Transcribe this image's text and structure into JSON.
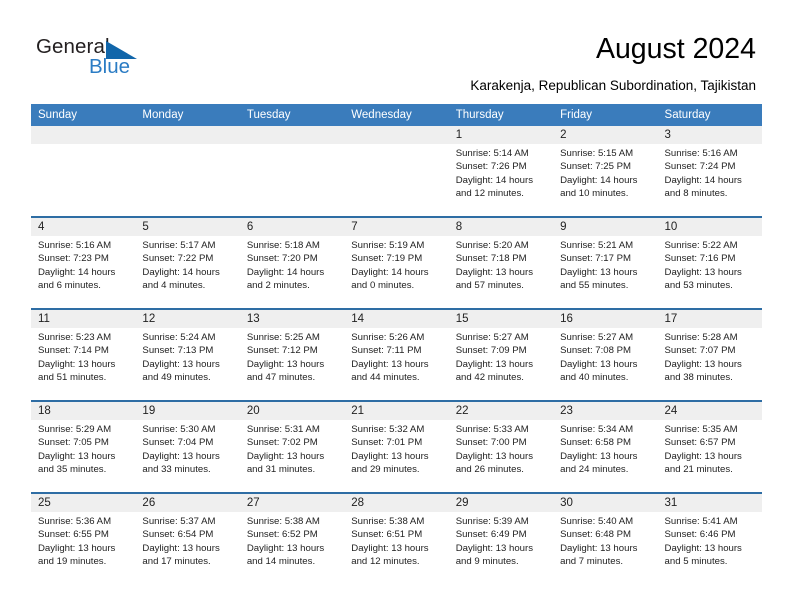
{
  "brand": {
    "name_part1": "General",
    "name_part2": "Blue",
    "mark": "triangle-flag-icon",
    "accent_color": "#2b7cc4"
  },
  "header": {
    "title": "August 2024",
    "subtitle": "Karakenja, Republican Subordination, Tajikistan"
  },
  "colors": {
    "header_blue": "#3a7cbc",
    "separator_blue": "#2e6da4",
    "daynum_band": "#efefef"
  },
  "calendar": {
    "weekday_headers": [
      "Sunday",
      "Monday",
      "Tuesday",
      "Wednesday",
      "Thursday",
      "Friday",
      "Saturday"
    ],
    "weeks": [
      [
        {
          "day": "",
          "sunrise": "",
          "sunset": "",
          "daylight_line1": "",
          "daylight_line2": ""
        },
        {
          "day": "",
          "sunrise": "",
          "sunset": "",
          "daylight_line1": "",
          "daylight_line2": ""
        },
        {
          "day": "",
          "sunrise": "",
          "sunset": "",
          "daylight_line1": "",
          "daylight_line2": ""
        },
        {
          "day": "",
          "sunrise": "",
          "sunset": "",
          "daylight_line1": "",
          "daylight_line2": ""
        },
        {
          "day": "1",
          "sunrise": "Sunrise: 5:14 AM",
          "sunset": "Sunset: 7:26 PM",
          "daylight_line1": "Daylight: 14 hours",
          "daylight_line2": "and 12 minutes."
        },
        {
          "day": "2",
          "sunrise": "Sunrise: 5:15 AM",
          "sunset": "Sunset: 7:25 PM",
          "daylight_line1": "Daylight: 14 hours",
          "daylight_line2": "and 10 minutes."
        },
        {
          "day": "3",
          "sunrise": "Sunrise: 5:16 AM",
          "sunset": "Sunset: 7:24 PM",
          "daylight_line1": "Daylight: 14 hours",
          "daylight_line2": "and 8 minutes."
        }
      ],
      [
        {
          "day": "4",
          "sunrise": "Sunrise: 5:16 AM",
          "sunset": "Sunset: 7:23 PM",
          "daylight_line1": "Daylight: 14 hours",
          "daylight_line2": "and 6 minutes."
        },
        {
          "day": "5",
          "sunrise": "Sunrise: 5:17 AM",
          "sunset": "Sunset: 7:22 PM",
          "daylight_line1": "Daylight: 14 hours",
          "daylight_line2": "and 4 minutes."
        },
        {
          "day": "6",
          "sunrise": "Sunrise: 5:18 AM",
          "sunset": "Sunset: 7:20 PM",
          "daylight_line1": "Daylight: 14 hours",
          "daylight_line2": "and 2 minutes."
        },
        {
          "day": "7",
          "sunrise": "Sunrise: 5:19 AM",
          "sunset": "Sunset: 7:19 PM",
          "daylight_line1": "Daylight: 14 hours",
          "daylight_line2": "and 0 minutes."
        },
        {
          "day": "8",
          "sunrise": "Sunrise: 5:20 AM",
          "sunset": "Sunset: 7:18 PM",
          "daylight_line1": "Daylight: 13 hours",
          "daylight_line2": "and 57 minutes."
        },
        {
          "day": "9",
          "sunrise": "Sunrise: 5:21 AM",
          "sunset": "Sunset: 7:17 PM",
          "daylight_line1": "Daylight: 13 hours",
          "daylight_line2": "and 55 minutes."
        },
        {
          "day": "10",
          "sunrise": "Sunrise: 5:22 AM",
          "sunset": "Sunset: 7:16 PM",
          "daylight_line1": "Daylight: 13 hours",
          "daylight_line2": "and 53 minutes."
        }
      ],
      [
        {
          "day": "11",
          "sunrise": "Sunrise: 5:23 AM",
          "sunset": "Sunset: 7:14 PM",
          "daylight_line1": "Daylight: 13 hours",
          "daylight_line2": "and 51 minutes."
        },
        {
          "day": "12",
          "sunrise": "Sunrise: 5:24 AM",
          "sunset": "Sunset: 7:13 PM",
          "daylight_line1": "Daylight: 13 hours",
          "daylight_line2": "and 49 minutes."
        },
        {
          "day": "13",
          "sunrise": "Sunrise: 5:25 AM",
          "sunset": "Sunset: 7:12 PM",
          "daylight_line1": "Daylight: 13 hours",
          "daylight_line2": "and 47 minutes."
        },
        {
          "day": "14",
          "sunrise": "Sunrise: 5:26 AM",
          "sunset": "Sunset: 7:11 PM",
          "daylight_line1": "Daylight: 13 hours",
          "daylight_line2": "and 44 minutes."
        },
        {
          "day": "15",
          "sunrise": "Sunrise: 5:27 AM",
          "sunset": "Sunset: 7:09 PM",
          "daylight_line1": "Daylight: 13 hours",
          "daylight_line2": "and 42 minutes."
        },
        {
          "day": "16",
          "sunrise": "Sunrise: 5:27 AM",
          "sunset": "Sunset: 7:08 PM",
          "daylight_line1": "Daylight: 13 hours",
          "daylight_line2": "and 40 minutes."
        },
        {
          "day": "17",
          "sunrise": "Sunrise: 5:28 AM",
          "sunset": "Sunset: 7:07 PM",
          "daylight_line1": "Daylight: 13 hours",
          "daylight_line2": "and 38 minutes."
        }
      ],
      [
        {
          "day": "18",
          "sunrise": "Sunrise: 5:29 AM",
          "sunset": "Sunset: 7:05 PM",
          "daylight_line1": "Daylight: 13 hours",
          "daylight_line2": "and 35 minutes."
        },
        {
          "day": "19",
          "sunrise": "Sunrise: 5:30 AM",
          "sunset": "Sunset: 7:04 PM",
          "daylight_line1": "Daylight: 13 hours",
          "daylight_line2": "and 33 minutes."
        },
        {
          "day": "20",
          "sunrise": "Sunrise: 5:31 AM",
          "sunset": "Sunset: 7:02 PM",
          "daylight_line1": "Daylight: 13 hours",
          "daylight_line2": "and 31 minutes."
        },
        {
          "day": "21",
          "sunrise": "Sunrise: 5:32 AM",
          "sunset": "Sunset: 7:01 PM",
          "daylight_line1": "Daylight: 13 hours",
          "daylight_line2": "and 29 minutes."
        },
        {
          "day": "22",
          "sunrise": "Sunrise: 5:33 AM",
          "sunset": "Sunset: 7:00 PM",
          "daylight_line1": "Daylight: 13 hours",
          "daylight_line2": "and 26 minutes."
        },
        {
          "day": "23",
          "sunrise": "Sunrise: 5:34 AM",
          "sunset": "Sunset: 6:58 PM",
          "daylight_line1": "Daylight: 13 hours",
          "daylight_line2": "and 24 minutes."
        },
        {
          "day": "24",
          "sunrise": "Sunrise: 5:35 AM",
          "sunset": "Sunset: 6:57 PM",
          "daylight_line1": "Daylight: 13 hours",
          "daylight_line2": "and 21 minutes."
        }
      ],
      [
        {
          "day": "25",
          "sunrise": "Sunrise: 5:36 AM",
          "sunset": "Sunset: 6:55 PM",
          "daylight_line1": "Daylight: 13 hours",
          "daylight_line2": "and 19 minutes."
        },
        {
          "day": "26",
          "sunrise": "Sunrise: 5:37 AM",
          "sunset": "Sunset: 6:54 PM",
          "daylight_line1": "Daylight: 13 hours",
          "daylight_line2": "and 17 minutes."
        },
        {
          "day": "27",
          "sunrise": "Sunrise: 5:38 AM",
          "sunset": "Sunset: 6:52 PM",
          "daylight_line1": "Daylight: 13 hours",
          "daylight_line2": "and 14 minutes."
        },
        {
          "day": "28",
          "sunrise": "Sunrise: 5:38 AM",
          "sunset": "Sunset: 6:51 PM",
          "daylight_line1": "Daylight: 13 hours",
          "daylight_line2": "and 12 minutes."
        },
        {
          "day": "29",
          "sunrise": "Sunrise: 5:39 AM",
          "sunset": "Sunset: 6:49 PM",
          "daylight_line1": "Daylight: 13 hours",
          "daylight_line2": "and 9 minutes."
        },
        {
          "day": "30",
          "sunrise": "Sunrise: 5:40 AM",
          "sunset": "Sunset: 6:48 PM",
          "daylight_line1": "Daylight: 13 hours",
          "daylight_line2": "and 7 minutes."
        },
        {
          "day": "31",
          "sunrise": "Sunrise: 5:41 AM",
          "sunset": "Sunset: 6:46 PM",
          "daylight_line1": "Daylight: 13 hours",
          "daylight_line2": "and 5 minutes."
        }
      ]
    ]
  }
}
